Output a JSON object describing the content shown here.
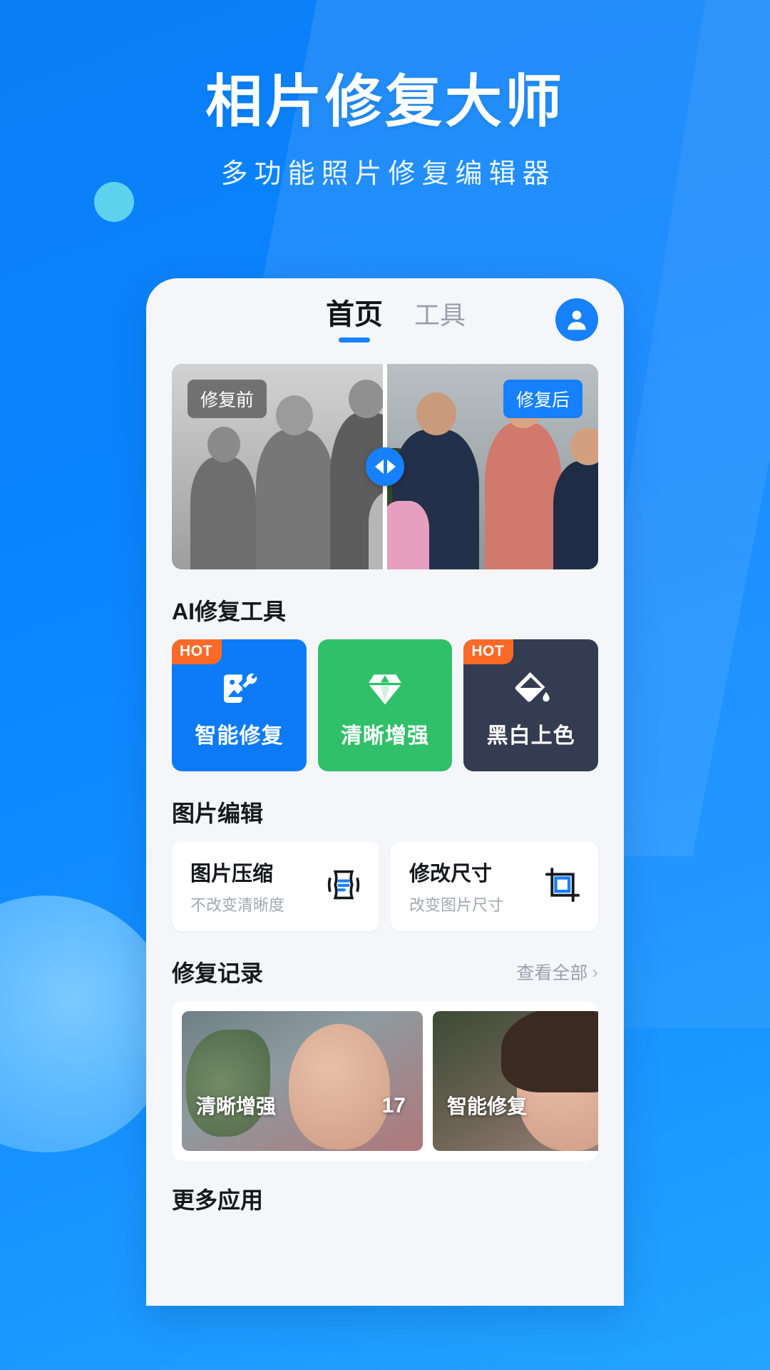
{
  "hero": {
    "title": "相片修复大师",
    "subtitle": "多功能照片修复编辑器"
  },
  "app": {
    "tabs": [
      {
        "label": "首页",
        "active": true
      },
      {
        "label": "工具",
        "active": false
      }
    ],
    "avatar_icon": "user-avatar-icon",
    "banner": {
      "before_label": "修复前",
      "after_label": "修复后",
      "slider_icon": "left-right-arrows-icon"
    },
    "ai_section": {
      "title": "AI修复工具",
      "cards": [
        {
          "label": "智能修复",
          "badge": "HOT",
          "color": "#0d7bf7",
          "icon": "image-repair-icon"
        },
        {
          "label": "清晰增强",
          "badge": "",
          "color": "#31c06a",
          "icon": "diamond-icon"
        },
        {
          "label": "黑白上色",
          "badge": "HOT",
          "color": "#333c50",
          "icon": "paint-bucket-icon"
        }
      ]
    },
    "edit_section": {
      "title": "图片编辑",
      "cards": [
        {
          "title": "图片压缩",
          "subtitle": "不改变清晰度",
          "icon": "compress-icon"
        },
        {
          "title": "修改尺寸",
          "subtitle": "改变图片尺寸",
          "icon": "crop-resize-icon"
        }
      ]
    },
    "records_section": {
      "title": "修复记录",
      "more_label": "查看全部",
      "more_icon": "chevron-right-icon",
      "items": [
        {
          "label": "清晰增强",
          "count": "17"
        },
        {
          "label": "智能修复",
          "count": ""
        }
      ]
    },
    "more_apps_title": "更多应用"
  },
  "colors": {
    "brand_blue": "#0a84ff",
    "accent_blue": "#1680ff",
    "hot_orange": "#f96a28",
    "green": "#31c06a",
    "dark_navy": "#333c50"
  }
}
